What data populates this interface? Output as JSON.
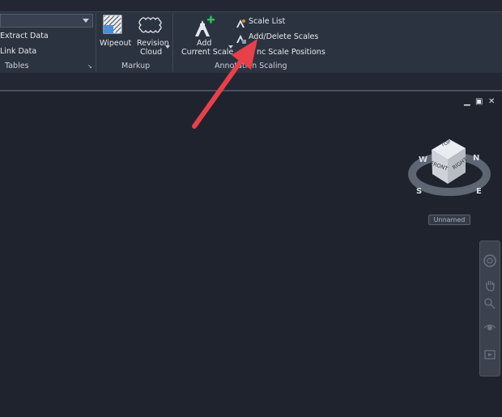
{
  "ribbon": {
    "tables_panel": {
      "title": "Tables",
      "items": [
        {
          "label": "Extract Data"
        },
        {
          "label": "Link Data"
        }
      ]
    },
    "markup_panel": {
      "title": "Markup",
      "wipeout": {
        "label": "Wipeout"
      },
      "revision_cloud": {
        "line1": "Revision",
        "line2": "Cloud"
      }
    },
    "annotation_scaling_panel": {
      "title": "Annotation Scaling",
      "add_current_scale": {
        "line1": "Add",
        "line2": "Current Scale"
      },
      "scale_list": {
        "label": "Scale List"
      },
      "add_delete_scales": {
        "label": "Add/Delete Scales"
      },
      "sync_scale_positions": {
        "label": "nc Scale Positions"
      }
    }
  },
  "viewcube": {
    "faces": {
      "top": "TOP",
      "front": "FRONT",
      "right": "RIGHT"
    },
    "compass": {
      "west": "W",
      "north": "N",
      "south": "S",
      "east": "E"
    }
  },
  "viewport_label": "Unnamed",
  "window_controls": {
    "minimize": "▁",
    "restore": "▣",
    "close": "✕"
  },
  "colors": {
    "annotation_arrow": "#e8404a",
    "accent_plus": "#2fc25b"
  }
}
